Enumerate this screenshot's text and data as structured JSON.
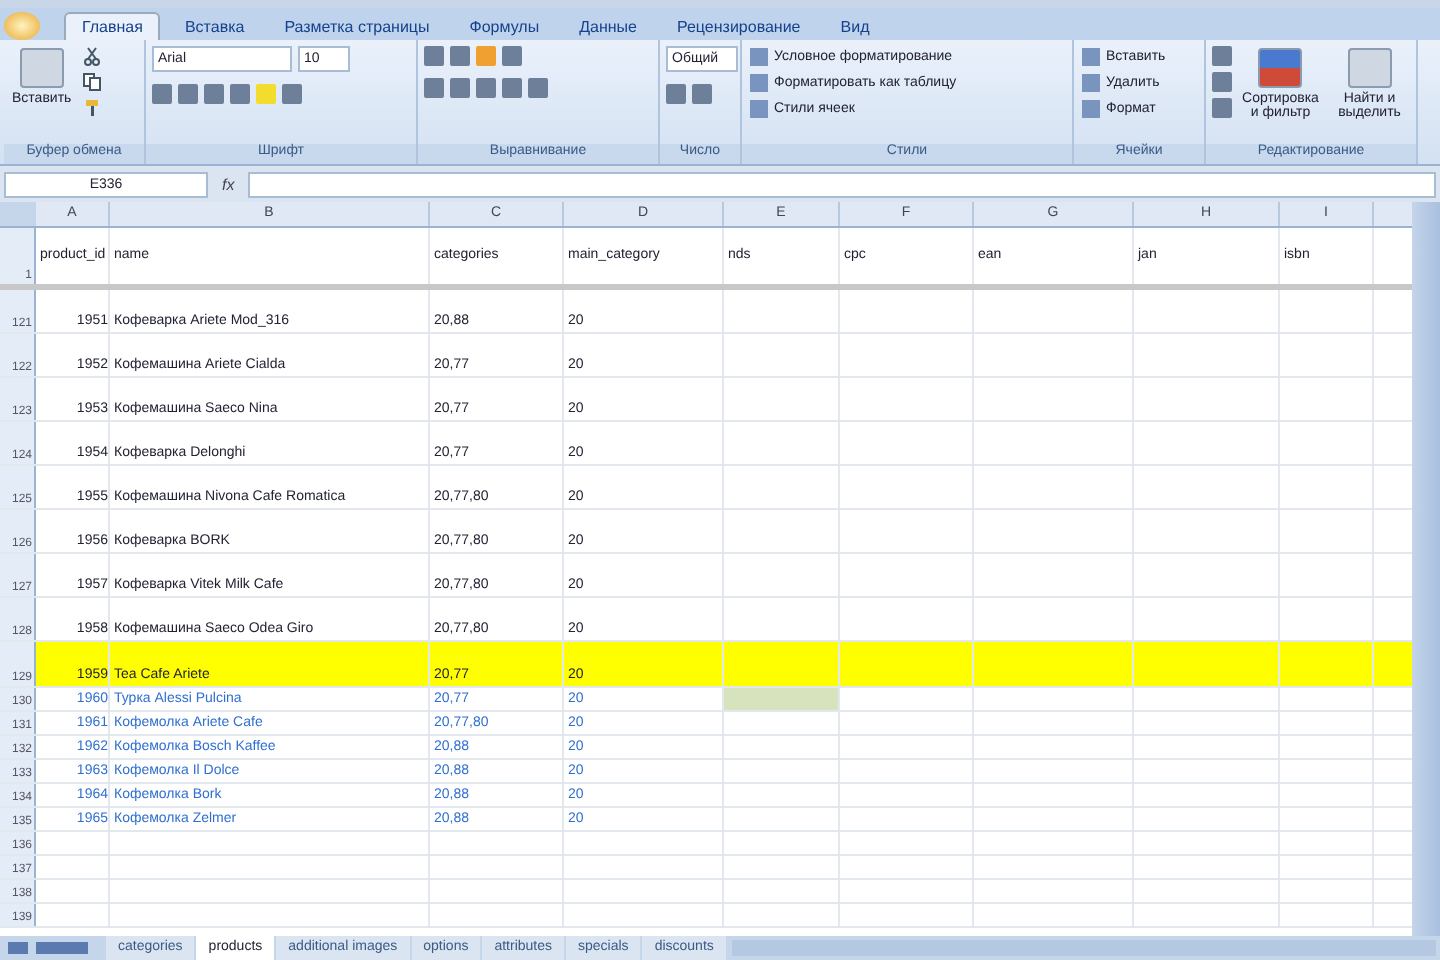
{
  "tabs": [
    {
      "label": "Главная",
      "selected": true
    },
    {
      "label": "Вставка",
      "selected": false
    },
    {
      "label": "Разметка страницы",
      "selected": false
    },
    {
      "label": "Формулы",
      "selected": false
    },
    {
      "label": "Данные",
      "selected": false
    },
    {
      "label": "Рецензирование",
      "selected": false
    },
    {
      "label": "Вид",
      "selected": false
    }
  ],
  "ribbon": {
    "paste": "Вставить",
    "font": "Arial",
    "size": "10",
    "number_format": "Общий",
    "styles": [
      "Условное форматирование",
      "Форматировать как таблицу",
      "Стили ячеек"
    ],
    "cells": [
      "Вставить",
      "Удалить",
      "Формат"
    ],
    "editing": [
      "Сортировка и фильтр",
      "Найти и выделить"
    ],
    "groups": [
      "Буфер обмена",
      "Шрифт",
      "Выравнивание",
      "Число",
      "Стили",
      "Ячейки",
      "Редактирование"
    ]
  },
  "formula_bar": {
    "name_box": "E336",
    "fx": "fx"
  },
  "columns": [
    "A",
    "B",
    "C",
    "D",
    "E",
    "F",
    "G",
    "H",
    "I"
  ],
  "header_row": {
    "number": "1",
    "cells": [
      "product_id",
      "name",
      "categories",
      "main_category",
      "nds",
      "cpc",
      "ean",
      "jan",
      "isbn"
    ]
  },
  "rows": [
    {
      "number": "121",
      "product_id": "1951",
      "name": "Кофеварка Ariete Mod_316",
      "categories": "20,88",
      "main_category": "20",
      "highlight": false,
      "link": false
    },
    {
      "number": "122",
      "product_id": "1952",
      "name": "Кофемашина Ariete Cialda",
      "categories": "20,77",
      "main_category": "20",
      "highlight": false,
      "link": false
    },
    {
      "number": "123",
      "product_id": "1953",
      "name": "Кофемашина Saeco Nina",
      "categories": "20,77",
      "main_category": "20",
      "highlight": false,
      "link": false
    },
    {
      "number": "124",
      "product_id": "1954",
      "name": "Кофеварка Delonghi",
      "categories": "20,77",
      "main_category": "20",
      "highlight": false,
      "link": false
    },
    {
      "number": "125",
      "product_id": "1955",
      "name": "Кофемашина Nivona Cafe Romatica",
      "categories": "20,77,80",
      "main_category": "20",
      "highlight": false,
      "link": false
    },
    {
      "number": "126",
      "product_id": "1956",
      "name": "Кофеварка BORK",
      "categories": "20,77,80",
      "main_category": "20",
      "highlight": false,
      "link": false
    },
    {
      "number": "127",
      "product_id": "1957",
      "name": "Кофеварка Vitek Milk Cafe",
      "categories": "20,77,80",
      "main_category": "20",
      "highlight": false,
      "link": false
    },
    {
      "number": "128",
      "product_id": "1958",
      "name": "Кофемашина Saeco Odea Giro",
      "categories": "20,77,80",
      "main_category": "20",
      "highlight": false,
      "link": false
    },
    {
      "number": "129",
      "product_id": "1959",
      "name": "Tea Cafe Ariete",
      "categories": "20,77",
      "main_category": "20",
      "highlight": true,
      "link": false
    },
    {
      "number": "130",
      "product_id": "1960",
      "name": "Турка Alessi Pulcina",
      "categories": "20,77",
      "main_category": "20",
      "highlight": false,
      "link": true
    },
    {
      "number": "131",
      "product_id": "1961",
      "name": "Кофемолка Ariete Cafe",
      "categories": "20,77,80",
      "main_category": "20",
      "highlight": false,
      "link": true
    },
    {
      "number": "132",
      "product_id": "1962",
      "name": "Кофемолка Bosch Kaffee",
      "categories": "20,88",
      "main_category": "20",
      "highlight": false,
      "link": true
    },
    {
      "number": "133",
      "product_id": "1963",
      "name": "Кофемолка Il Dolce",
      "categories": "20,88",
      "main_category": "20",
      "highlight": false,
      "link": true
    },
    {
      "number": "134",
      "product_id": "1964",
      "name": "Кофемолка Bork",
      "categories": "20,88",
      "main_category": "20",
      "highlight": false,
      "link": true
    },
    {
      "number": "135",
      "product_id": "1965",
      "name": "Кофемолка Zelmer",
      "categories": "20,88",
      "main_category": "20",
      "highlight": false,
      "link": true
    }
  ],
  "empty_rows": [
    "136",
    "137",
    "138",
    "139"
  ],
  "sheets": [
    {
      "label": "categories",
      "selected": false
    },
    {
      "label": "products",
      "selected": true
    },
    {
      "label": "additional images",
      "selected": false
    },
    {
      "label": "options",
      "selected": false
    },
    {
      "label": "attributes",
      "selected": false
    },
    {
      "label": "specials",
      "selected": false
    },
    {
      "label": "discounts",
      "selected": false
    }
  ]
}
